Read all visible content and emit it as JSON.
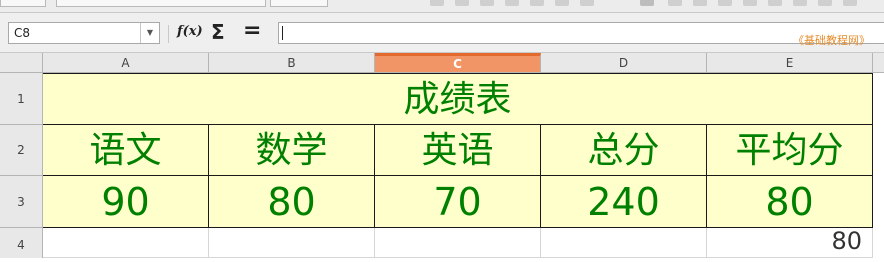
{
  "toolbar": {
    "fx_icon": "f(x)",
    "sigma_icon": "Σ",
    "equals_icon": "="
  },
  "name_box": {
    "value": "C8",
    "dropdown_icon": "▼"
  },
  "formula": {
    "value": ""
  },
  "watermark": "《基础教程网》",
  "columns": [
    "A",
    "B",
    "C",
    "D",
    "E"
  ],
  "selected_column": "C",
  "rows": [
    "1",
    "2",
    "3",
    "4"
  ],
  "cells": {
    "title": "成绩表",
    "A2": "语文",
    "B2": "数学",
    "C2": "英语",
    "D2": "总分",
    "E2": "平均分",
    "A3": "90",
    "B3": "80",
    "C3": "70",
    "D3": "240",
    "E3": "80",
    "E4": "80"
  },
  "colors": {
    "fill": "#ffffcc",
    "text": "#008000",
    "selected_header": "#f19566",
    "watermark": "#e58c2b"
  }
}
